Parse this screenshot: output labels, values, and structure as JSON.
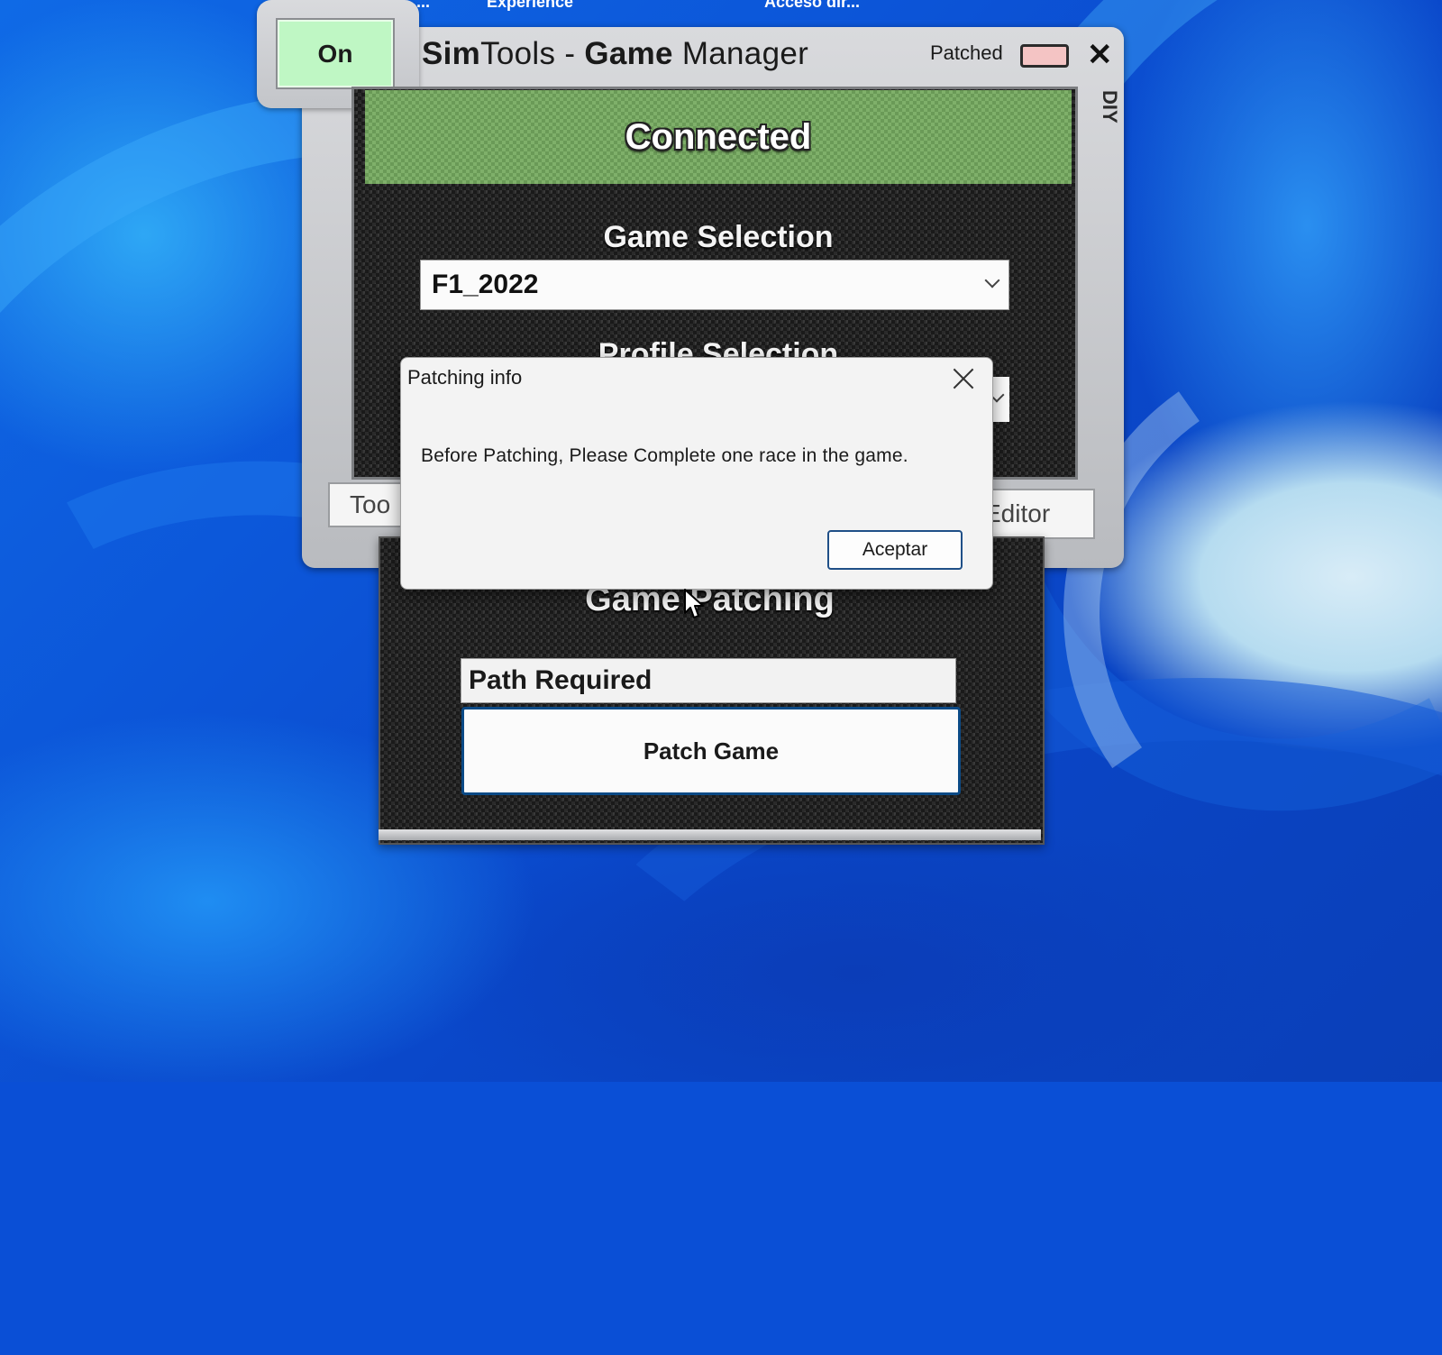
{
  "desktop": {
    "partial_top_texts": [
      "...",
      "Experience",
      "Acceso dir..."
    ]
  },
  "game_manager": {
    "on_button": "On",
    "title_bold_1": "Sim",
    "title_1": "Tools - ",
    "title_bold_2": "Game",
    "title_2": " Manager",
    "patched_label": "Patched",
    "close_glyph": "✕",
    "diy_tab": "DIY",
    "status": "Connected",
    "game_selection_label": "Game Selection",
    "game_selection_value": "F1_2022",
    "profile_selection_label": "Profile Selection",
    "tools_button": "Too",
    "editor_button": "Editor",
    "colors": {
      "connected": "#7fb06a",
      "on_button": "#bff7c4",
      "patched_led": "#f4c4c4"
    }
  },
  "game_patching": {
    "title": "Game Patching",
    "path_field": "Path Required",
    "patch_button": "Patch Game"
  },
  "dialog": {
    "title": "Patching info",
    "message": "Before Patching, Please Complete one race in the game.",
    "ok_button": "Aceptar",
    "close_icon": "close-icon"
  }
}
